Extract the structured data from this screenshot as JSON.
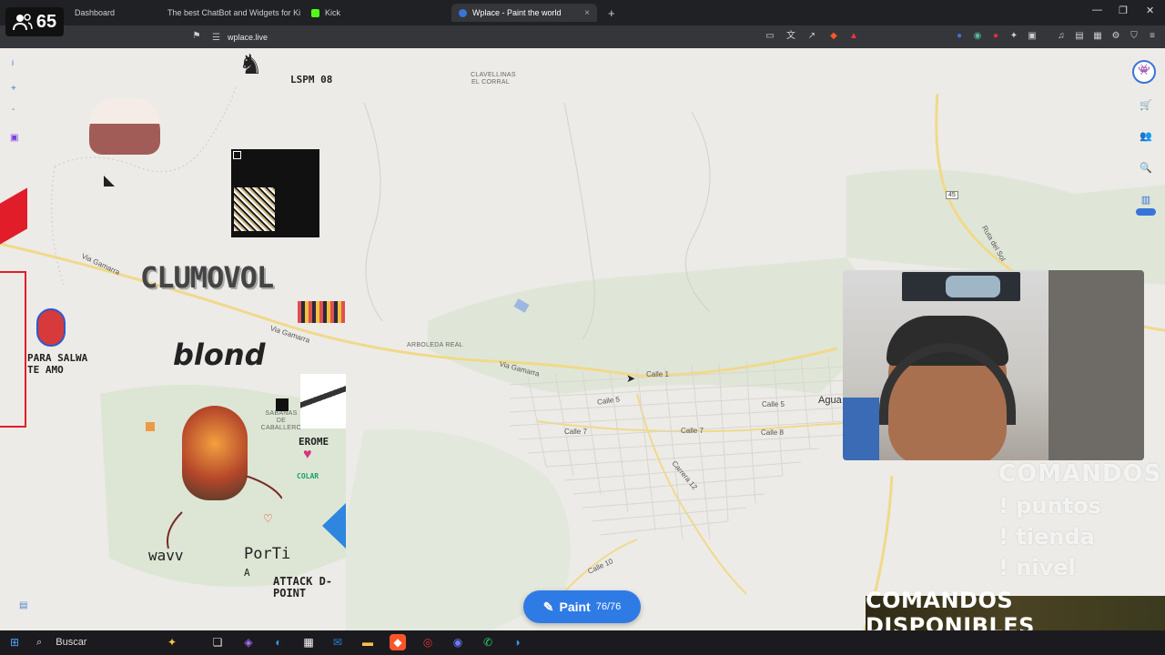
{
  "browser": {
    "tabs": [
      {
        "title": "Dashboard",
        "color": "#53fc18"
      },
      {
        "title": "The best ChatBot and Widgets for Ki",
        "color": "#7b61ff"
      },
      {
        "title": "Kick",
        "color": "#53fc18"
      },
      {
        "title": "Wplace - Paint the world",
        "color": "#3a74d8",
        "active": true
      }
    ],
    "url": "wplace.live",
    "new_tab": "+",
    "close_glyph": "×"
  },
  "stream": {
    "viewer_count": "65"
  },
  "map": {
    "place_labels": [
      "CLAVELLINAS EL CORRAL",
      "ARBOLEDA REAL",
      "SABANAS DE CABALLERO"
    ],
    "street_labels": [
      "Via Gamarra",
      "Via Gamarra",
      "Via Gamarra",
      "Calle 1",
      "Calle 5",
      "Calle 5",
      "Calle 7",
      "Calle 7",
      "Calle 8",
      "Carrera 12",
      "Calle 10",
      "Ruta del Sol"
    ],
    "town_label": "Agua",
    "road_shield": "45"
  },
  "artworks": {
    "lspm": "LSPM 08",
    "clumovol": "CLUMOVOL",
    "blond": "blond",
    "para_salwa": "PARA SALWA TE AMO",
    "erome": "EROME",
    "porti": "PorTi",
    "porti_a": "A",
    "attack": "ATTACK D-POINT",
    "wavy": "wavv",
    "colar": "COLAR"
  },
  "toolbar_left": {
    "info": "i",
    "zoom_in": "+",
    "zoom_out": "-"
  },
  "paint_button": {
    "label": "Paint",
    "count": "76/76"
  },
  "commands": {
    "title": "COMANDOS",
    "items": [
      "! puntos",
      "! tienda",
      "! nivel"
    ],
    "banner": "COMANDOS DISPONIBLES"
  },
  "taskbar": {
    "search_label": "Buscar"
  }
}
